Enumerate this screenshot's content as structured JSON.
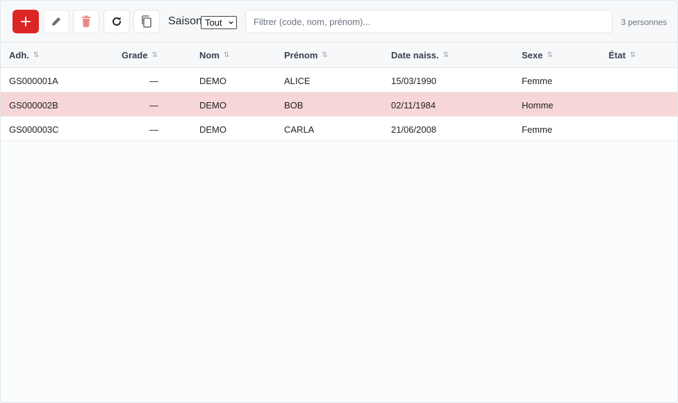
{
  "toolbar": {
    "add_icon": "plus-icon",
    "edit_icon": "pencil-icon",
    "delete_icon": "trash-icon",
    "refresh_icon": "refresh-icon",
    "copy_icon": "copy-icon",
    "saison_label": "Saison",
    "saison_value": "Tout",
    "filter_placeholder": "Filtrer (code, nom, prénom)...",
    "filter_value": "",
    "count_text": "3 personnes",
    "accent_color": "#dc2626"
  },
  "table": {
    "columns": [
      {
        "key": "adh",
        "label": "Adh."
      },
      {
        "key": "grade",
        "label": "Grade"
      },
      {
        "key": "nom",
        "label": "Nom"
      },
      {
        "key": "prenom",
        "label": "Prénom"
      },
      {
        "key": "date",
        "label": "Date naiss."
      },
      {
        "key": "sexe",
        "label": "Sexe"
      },
      {
        "key": "etat",
        "label": "État"
      }
    ],
    "sort_icon": "⇅",
    "rows": [
      {
        "adh": "GS000001A",
        "grade": "—",
        "nom": "DEMO",
        "prenom": "ALICE",
        "date": "15/03/1990",
        "sexe": "Femme",
        "etat": "",
        "selected": false
      },
      {
        "adh": "GS000002B",
        "grade": "—",
        "nom": "DEMO",
        "prenom": "BOB",
        "date": "02/11/1984",
        "sexe": "Homme",
        "etat": "",
        "selected": true
      },
      {
        "adh": "GS000003C",
        "grade": "—",
        "nom": "DEMO",
        "prenom": "CARLA",
        "date": "21/06/2008",
        "sexe": "Femme",
        "etat": "",
        "selected": false
      }
    ],
    "selected_row_color": "#f6d6d8"
  }
}
